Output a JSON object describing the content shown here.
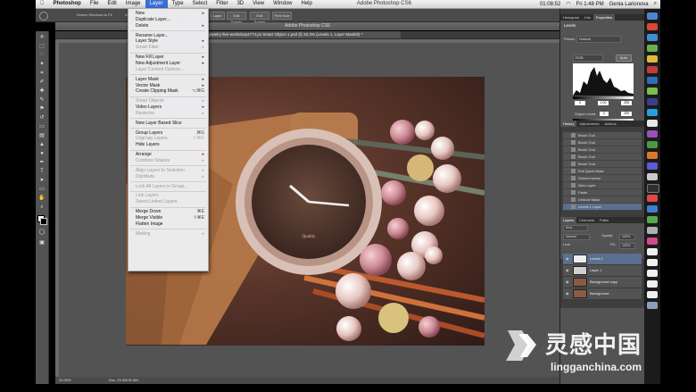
{
  "menubar": {
    "apple": "",
    "items": [
      "Photoshop",
      "File",
      "Edit",
      "Image",
      "Layer",
      "Type",
      "Select",
      "Filter",
      "3D",
      "View",
      "Window",
      "Help"
    ],
    "selected_index": 4,
    "app_title": "Adobe Photoshop CS6",
    "clock": "Fri 1:48 PM",
    "user": "Genia Larionova",
    "recording": "01:08:52"
  },
  "options_bar": {
    "btn1": "Refine Edge",
    "btn2": "1 Layer",
    "btn3": "Edit Screen",
    "btn4": "Edit Screen",
    "btn5": "Print Size",
    "text1": "Resize Windows to Fit",
    "text2": "Zoom All Windows"
  },
  "document": {
    "window_title": "Adobe Photoshop CS6",
    "tab_label": "jewelry-live-workshop4774.ps Smart Object-1.psd @ 33.3% (Levels 1, Layer Mask/8) *",
    "zoom": "33.33%",
    "status": "Doc: 23.9M/31.8M",
    "watch_brand": "Quality"
  },
  "layer_menu": {
    "items": [
      {
        "label": "New",
        "shortcut": "",
        "submenu": true,
        "disabled": false
      },
      {
        "label": "Duplicate Layer...",
        "shortcut": "",
        "submenu": false,
        "disabled": false
      },
      {
        "label": "Delete",
        "shortcut": "",
        "submenu": true,
        "disabled": false
      },
      {
        "sep": true
      },
      {
        "label": "Rename Layer...",
        "shortcut": "",
        "submenu": false,
        "disabled": false
      },
      {
        "label": "Layer Style",
        "shortcut": "",
        "submenu": true,
        "disabled": false
      },
      {
        "label": "Smart Filter",
        "shortcut": "",
        "submenu": true,
        "disabled": true
      },
      {
        "sep": true
      },
      {
        "label": "New Fill Layer",
        "shortcut": "",
        "submenu": true,
        "disabled": false
      },
      {
        "label": "New Adjustment Layer",
        "shortcut": "",
        "submenu": true,
        "disabled": false
      },
      {
        "label": "Layer Content Options...",
        "shortcut": "",
        "submenu": false,
        "disabled": true
      },
      {
        "sep": true
      },
      {
        "label": "Layer Mask",
        "shortcut": "",
        "submenu": true,
        "disabled": false
      },
      {
        "label": "Vector Mask",
        "shortcut": "",
        "submenu": true,
        "disabled": false
      },
      {
        "label": "Create Clipping Mask",
        "shortcut": "⌥⌘G",
        "submenu": false,
        "disabled": false
      },
      {
        "sep": true
      },
      {
        "label": "Smart Objects",
        "shortcut": "",
        "submenu": true,
        "disabled": true
      },
      {
        "label": "Video Layers",
        "shortcut": "",
        "submenu": true,
        "disabled": false
      },
      {
        "label": "Rasterize",
        "shortcut": "",
        "submenu": true,
        "disabled": true
      },
      {
        "sep": true
      },
      {
        "label": "New Layer Based Slice",
        "shortcut": "",
        "submenu": false,
        "disabled": false
      },
      {
        "sep": true
      },
      {
        "label": "Group Layers",
        "shortcut": "⌘G",
        "submenu": false,
        "disabled": false
      },
      {
        "label": "Ungroup Layers",
        "shortcut": "⇧⌘G",
        "submenu": false,
        "disabled": true
      },
      {
        "label": "Hide Layers",
        "shortcut": "",
        "submenu": false,
        "disabled": false
      },
      {
        "sep": true
      },
      {
        "label": "Arrange",
        "shortcut": "",
        "submenu": true,
        "disabled": false
      },
      {
        "label": "Combine Shapes",
        "shortcut": "",
        "submenu": true,
        "disabled": true
      },
      {
        "sep": true
      },
      {
        "label": "Align Layers to Selection",
        "shortcut": "",
        "submenu": true,
        "disabled": true
      },
      {
        "label": "Distribute",
        "shortcut": "",
        "submenu": true,
        "disabled": true
      },
      {
        "sep": true
      },
      {
        "label": "Lock All Layers in Group...",
        "shortcut": "",
        "submenu": false,
        "disabled": true
      },
      {
        "sep": true
      },
      {
        "label": "Link Layers",
        "shortcut": "",
        "submenu": false,
        "disabled": true
      },
      {
        "label": "Select Linked Layers",
        "shortcut": "",
        "submenu": false,
        "disabled": true
      },
      {
        "sep": true
      },
      {
        "label": "Merge Down",
        "shortcut": "⌘E",
        "submenu": false,
        "disabled": false
      },
      {
        "label": "Merge Visible",
        "shortcut": "⇧⌘E",
        "submenu": false,
        "disabled": false
      },
      {
        "label": "Flatten Image",
        "shortcut": "",
        "submenu": false,
        "disabled": false
      },
      {
        "sep": true
      },
      {
        "label": "Matting",
        "shortcut": "",
        "submenu": true,
        "disabled": true
      }
    ]
  },
  "properties_panel": {
    "tabs": [
      "Histogram",
      "Info",
      "Properties"
    ],
    "active_tab": 2,
    "title": "Levels",
    "preset_label": "Preset:",
    "preset_value": "Default",
    "channel": "RGB",
    "auto": "Auto",
    "input_values": [
      "0",
      "1.00",
      "255"
    ],
    "output_label": "Output Levels:",
    "output_values": [
      "0",
      "255"
    ]
  },
  "history_panel": {
    "tabs": [
      "History",
      "Adjustments",
      "Actions"
    ],
    "items": [
      "Brush Tool",
      "Brush Tool",
      "Brush Tool",
      "Brush Tool",
      "Brush Tool",
      "Exit Quick Mask",
      "Select Inverse",
      "New Layer",
      "Paste",
      "Undock Mask",
      "Levels 1 Layer"
    ],
    "selected_index": 10
  },
  "layers_panel": {
    "tabs": [
      "Layers",
      "Channels",
      "Paths"
    ],
    "kind": "Kind",
    "blend_mode": "Normal",
    "opacity_label": "Opacity:",
    "opacity": "100%",
    "lock_label": "Lock:",
    "fill_label": "Fill:",
    "fill": "100%",
    "layers": [
      {
        "name": "Levels 1",
        "selected": true
      },
      {
        "name": "Layer 1",
        "selected": false
      },
      {
        "name": "Background copy",
        "selected": false
      },
      {
        "name": "Background",
        "selected": false
      }
    ]
  },
  "watermark": {
    "cn": "灵感中国",
    "url": "lingganchina.com"
  },
  "colors": {
    "menu_highlight": "#3b6fd6",
    "selected_row": "#5b6f8e",
    "panel_bg": "#3e3e3e"
  }
}
